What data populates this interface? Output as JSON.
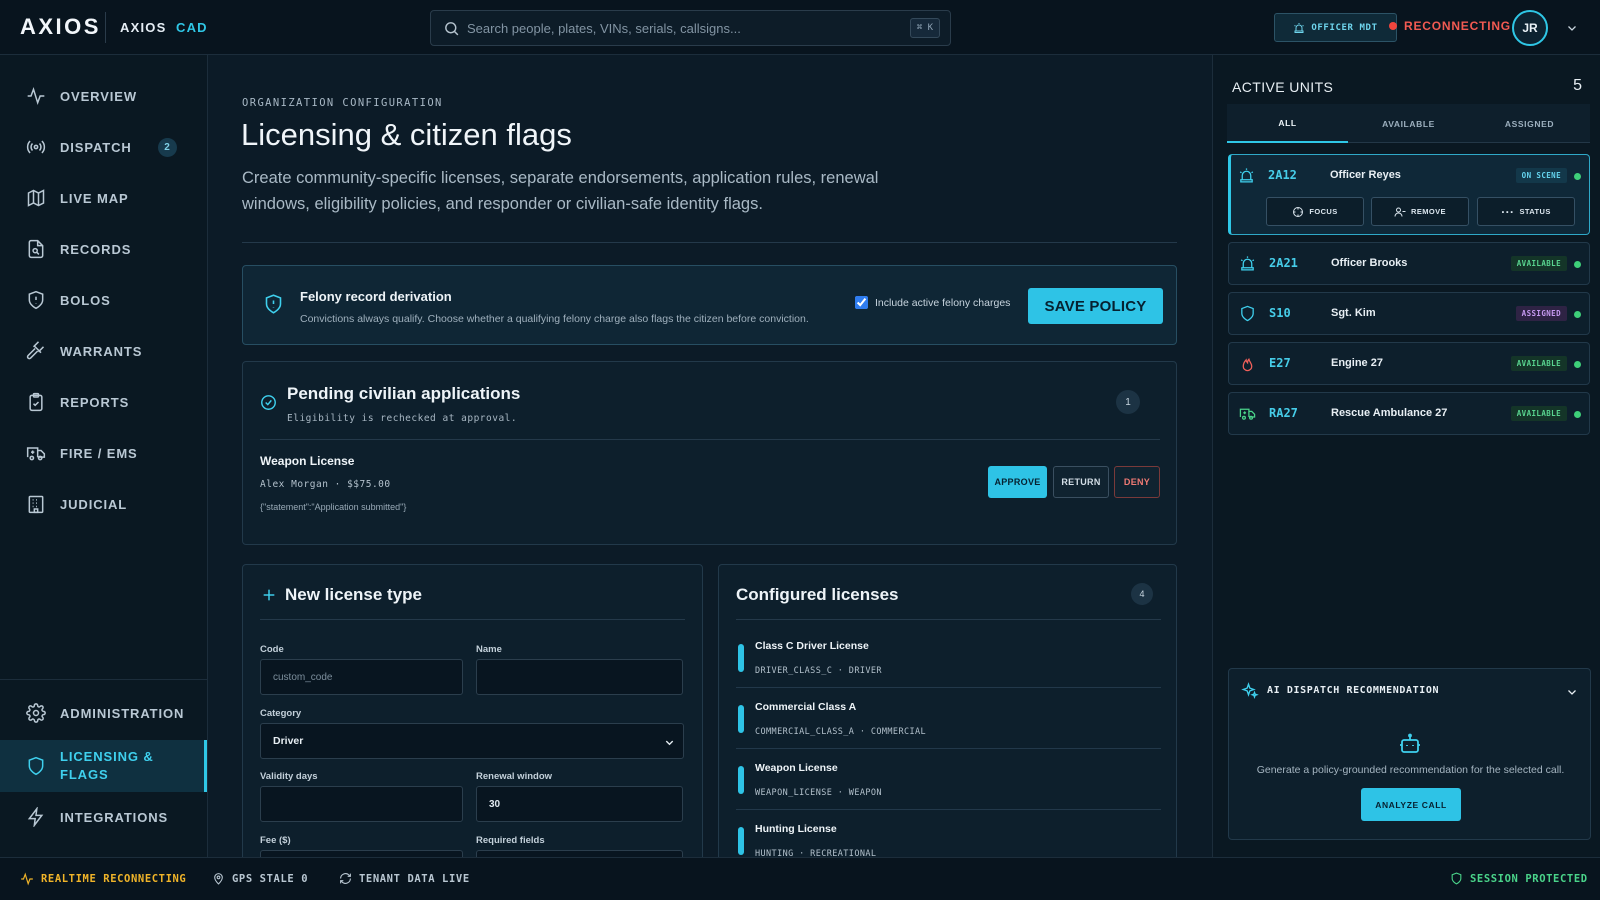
{
  "app": {
    "brand": "AXIOS",
    "product_name": "AXIOS",
    "product_suffix": "CAD"
  },
  "header": {
    "search_placeholder": "Search people, plates, VINs, serials, callsigns...",
    "search_shortcut": "⌘ K",
    "mdt_label": "OFFICER MDT",
    "connection_status": "RECONNECTING",
    "user_initials": "JR"
  },
  "sidebar": {
    "items": [
      {
        "label": "OVERVIEW",
        "icon": "activity-icon"
      },
      {
        "label": "DISPATCH",
        "icon": "broadcast-icon",
        "badge": "2"
      },
      {
        "label": "LIVE MAP",
        "icon": "map-icon"
      },
      {
        "label": "RECORDS",
        "icon": "file-search-icon"
      },
      {
        "label": "BOLOS",
        "icon": "shield-alert-icon"
      },
      {
        "label": "WARRANTS",
        "icon": "gavel-icon"
      },
      {
        "label": "REPORTS",
        "icon": "clipboard-icon"
      },
      {
        "label": "FIRE / EMS",
        "icon": "ambulance-icon"
      },
      {
        "label": "JUDICIAL",
        "icon": "building-icon"
      }
    ],
    "bottom_items": [
      {
        "label": "ADMINISTRATION",
        "icon": "gear-icon"
      },
      {
        "label": "LICENSING & FLAGS",
        "icon": "shield-icon",
        "active": true
      },
      {
        "label": "INTEGRATIONS",
        "icon": "zap-icon"
      }
    ]
  },
  "main": {
    "eyebrow": "ORGANIZATION CONFIGURATION",
    "title": "Licensing & citizen flags",
    "description": "Create community-specific licenses, separate endorsements, application rules, renewal windows, eligibility policies, and responder or civilian-safe identity flags.",
    "policy": {
      "title": "Felony record derivation",
      "description": "Convictions always qualify. Choose whether a qualifying felony charge also flags the citizen before conviction.",
      "checkbox_label": "Include active felony charges",
      "checkbox_checked": true,
      "save_label": "SAVE POLICY"
    },
    "pending": {
      "title": "Pending civilian applications",
      "subtitle": "Eligibility is rechecked at approval.",
      "count": "1",
      "application": {
        "title": "Weapon License",
        "meta": "Alex Morgan · $$75.00",
        "payload": "{\"statement\":\"Application submitted\"}",
        "approve_label": "APPROVE",
        "return_label": "RETURN",
        "deny_label": "DENY"
      }
    },
    "new_license": {
      "title": "New license type",
      "code_label": "Code",
      "code_placeholder": "custom_code",
      "code_value": "",
      "name_label": "Name",
      "name_value": "",
      "category_label": "Category",
      "category_value": "Driver",
      "validity_label": "Validity days",
      "validity_value": "",
      "renewal_label": "Renewal window",
      "renewal_value": "30",
      "fee_label": "Fee ($)",
      "required_label": "Required fields"
    },
    "configured": {
      "title": "Configured licenses",
      "count": "4",
      "items": [
        {
          "name": "Class C Driver License",
          "code": "DRIVER_CLASS_C · DRIVER"
        },
        {
          "name": "Commercial Class A",
          "code": "COMMERCIAL_CLASS_A · COMMERCIAL"
        },
        {
          "name": "Weapon License",
          "code": "WEAPON_LICENSE · WEAPON"
        },
        {
          "name": "Hunting License",
          "code": "HUNTING · RECREATIONAL"
        }
      ]
    }
  },
  "units_panel": {
    "title": "ACTIVE UNITS",
    "count": "5",
    "tabs": [
      "ALL",
      "AVAILABLE",
      "ASSIGNED"
    ],
    "units": [
      {
        "callsign": "2A12",
        "name": "Officer Reyes",
        "status": "ON SCENE",
        "icon": "police-light-icon"
      },
      {
        "callsign": "2A21",
        "name": "Officer Brooks",
        "status": "AVAILABLE",
        "icon": "police-light-icon"
      },
      {
        "callsign": "S10",
        "name": "Sgt. Kim",
        "status": "ASSIGNED",
        "icon": "shield-icon"
      },
      {
        "callsign": "E27",
        "name": "Engine 27",
        "status": "AVAILABLE",
        "icon": "flame-icon"
      },
      {
        "callsign": "RA27",
        "name": "Rescue Ambulance 27",
        "status": "AVAILABLE",
        "icon": "ambulance-icon"
      }
    ],
    "unit_actions": [
      "FOCUS",
      "REMOVE",
      "STATUS"
    ],
    "ai": {
      "title": "AI DISPATCH RECOMMENDATION",
      "description": "Generate a policy-grounded recommendation for the selected call.",
      "button_label": "ANALYZE CALL"
    }
  },
  "statusbar": {
    "realtime": "REALTIME RECONNECTING",
    "gps": "GPS STALE 0",
    "tenant": "TENANT DATA LIVE",
    "session": "SESSION PROTECTED"
  },
  "colors": {
    "accent": "#2ec3e6",
    "danger": "#f25a52",
    "success": "#3ecf79",
    "warning": "#f0b429"
  }
}
